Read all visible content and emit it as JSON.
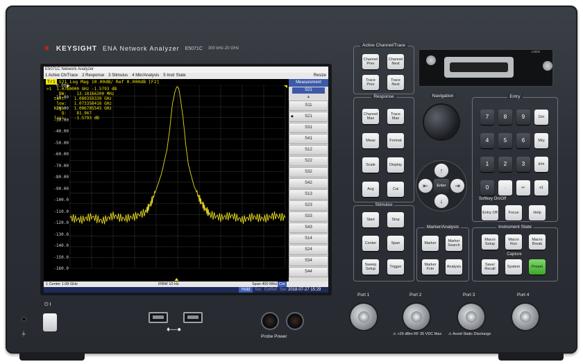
{
  "branding": {
    "logo_icon": "keysight-wave-icon",
    "brand": "KEYSIGHT",
    "product": "ENA Network Analyzer",
    "model": "E5071C",
    "range": "300 kHz-20 GHz"
  },
  "screen": {
    "window_title": "E5071C Network Analyzer",
    "menu": [
      "1 Active Ch/Trace",
      "2 Response",
      "3 Stimulus",
      "4 Mkr/Analysis",
      "5 Instr State"
    ],
    "resize_label": "Resize",
    "trace_badge": "Tr1",
    "trace_info": "S21 Log Mag 10.00dB/ Ref 0.000dB [F2]",
    "marker_readout": ">1  1.0780000 GHz -1.5793 dB\n     BW:    13.18166200 MHz\n   cent:   1.080359339 GHz\n    low:   1.073358416 GHz\n   high:   1.086785545 GHz\n      Q:    81.967\n   loss:   -1.5793 dB",
    "y_ticks": [
      "0.000",
      "-10.00",
      "-20.00",
      "-30.00",
      "-40.00",
      "-50.00",
      "-60.00",
      "-70.00",
      "-80.00",
      "-90.00",
      "-100.0",
      "-110.0",
      "-120.0",
      "-130.0",
      "-140.0",
      "-150.0",
      "-160.0"
    ],
    "measurement": {
      "header": "Measurement",
      "selected": "S21",
      "items": [
        "S11",
        "S21",
        "S31",
        "S41",
        "S12",
        "S22",
        "S32",
        "S42",
        "S13",
        "S23",
        "S33",
        "S43",
        "S14",
        "S24",
        "S34",
        "S44"
      ]
    },
    "status": {
      "center": "1  Center 1.08 GHz",
      "ifbw": "IFBW 10 Hz",
      "span": "Span 400 MHz",
      "cor": "Cor",
      "hold": "Hold",
      "svc": "Svc",
      "extref": "ExtRef",
      "svc2": "Svc",
      "datetime": "2018-07-27 15:29"
    }
  },
  "chart_data": {
    "type": "line",
    "title": "",
    "xlabel": "",
    "ylabel": "",
    "x_center_ghz": 1.08,
    "x_span_mhz": 400,
    "x": [
      0.88,
      0.9,
      0.92,
      0.94,
      0.96,
      0.98,
      1.0,
      1.02,
      1.03,
      1.04,
      1.05,
      1.06,
      1.065,
      1.07,
      1.075,
      1.078,
      1.08,
      1.082,
      1.085,
      1.09,
      1.095,
      1.1,
      1.11,
      1.12,
      1.13,
      1.14,
      1.16,
      1.18,
      1.2,
      1.22,
      1.24,
      1.26,
      1.28
    ],
    "series": [
      {
        "values": [
          -123,
          -125,
          -122,
          -126,
          -121,
          -124,
          -122,
          -118,
          -110,
          -97,
          -82,
          -60,
          -42,
          -18,
          -6,
          -1.6,
          -1.5,
          -3,
          -12,
          -30,
          -55,
          -74,
          -93,
          -105,
          -114,
          -120,
          -123,
          -121,
          -125,
          -122,
          -124,
          -121,
          -123
        ],
        "color": "#e9dc1e"
      }
    ],
    "ylim": [
      -170,
      0
    ],
    "yticks_step": 10,
    "grid": true,
    "marker": {
      "label": "1",
      "x": 1.078,
      "y": -1.5793
    }
  },
  "front_panel": {
    "sections": {
      "active": "Active Channel/Trace",
      "response": "Response",
      "navigation": "Navigation",
      "entry": "Entry",
      "stimulus": "Stimulus",
      "marker": "Marker/Analysis",
      "instr": "Instrument State"
    },
    "keys": {
      "ch_prev": "Channel Prev",
      "ch_next": "Channel Next",
      "tr_prev": "Trace Prev",
      "tr_next": "Trace Next",
      "ch_max": "Channel Max",
      "tr_max": "Trace Max",
      "meas": "Meas",
      "format": "Format",
      "scale": "Scale",
      "display": "Display",
      "avg": "Avg",
      "cal": "Cal",
      "start": "Start",
      "stop": "Stop",
      "center": "Center",
      "span": "Span",
      "sweep": "Sweep Setup",
      "trigger": "Trigger",
      "marker": "Marker",
      "mkr_search": "Marker Search",
      "mkr_fctn": "Marker Fctn",
      "analysis": "Analysis",
      "macro_setup": "Macro Setup",
      "macro_run": "Macro Run",
      "macro_break": "Macro Break",
      "save": "Save/ Recall",
      "system": "System",
      "preset": "Preset",
      "enter": "Enter",
      "entry_off": "Entry Off",
      "focus": "Focus",
      "help": "Help"
    },
    "numpad": [
      "7",
      "8",
      "9",
      "G/n",
      "4",
      "5",
      "6",
      "M/μ",
      "1",
      "2",
      "3",
      "k/m",
      "0",
      ".",
      "+/-",
      "x1"
    ],
    "softkey_label": "Softkey On/Off",
    "capture_label": "Capture",
    "lock_label": "LOCK",
    "ports": [
      "Port 1",
      "Port 2",
      "Port 3",
      "Port 4"
    ],
    "warning_rf": "+26 dBm RF  35 VDC Max",
    "warning_static": "Avoid Static Discharge",
    "probe_power": "Probe Power",
    "power_label": "⏻ I",
    "usb_icon": "usb-icon"
  }
}
